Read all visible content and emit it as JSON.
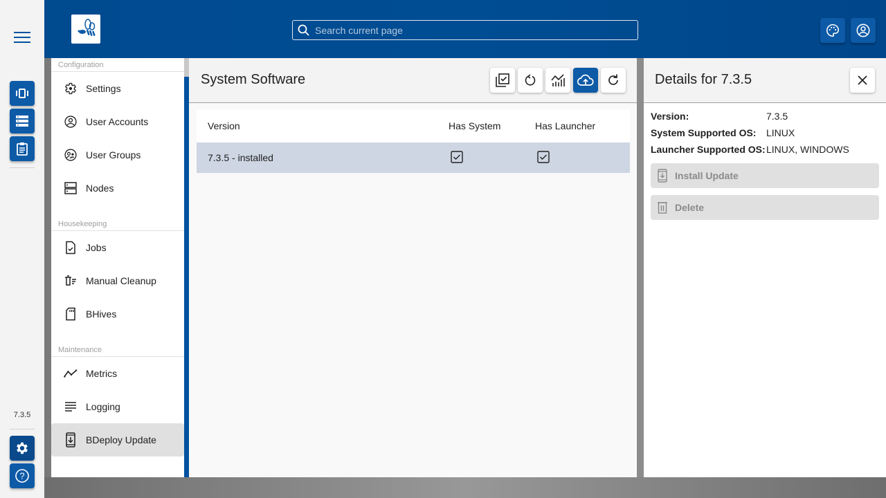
{
  "rail": {
    "version": "7.3.5",
    "buttons": [
      "instances-icon",
      "list-icon",
      "clipboard-icon"
    ],
    "bottom_buttons": [
      "settings-icon",
      "help-icon"
    ]
  },
  "header": {
    "search": {
      "placeholder": "Search current page",
      "value": ""
    },
    "buttons": [
      "palette-icon",
      "account-icon"
    ]
  },
  "nav": {
    "groups": [
      {
        "label": "Configuration",
        "items": [
          {
            "label": "Settings",
            "icon": "gear-icon"
          },
          {
            "label": "User Accounts",
            "icon": "account-circle-icon"
          },
          {
            "label": "User Groups",
            "icon": "group-icon"
          },
          {
            "label": "Nodes",
            "icon": "nodes-icon"
          }
        ]
      },
      {
        "label": "Housekeeping",
        "items": [
          {
            "label": "Jobs",
            "icon": "task-icon"
          },
          {
            "label": "Manual Cleanup",
            "icon": "cleanup-icon"
          },
          {
            "label": "BHives",
            "icon": "sd-card-icon"
          }
        ]
      },
      {
        "label": "Maintenance",
        "items": [
          {
            "label": "Metrics",
            "icon": "metrics-icon"
          },
          {
            "label": "Logging",
            "icon": "logging-icon"
          },
          {
            "label": "BDeploy Update",
            "icon": "system-update-icon",
            "active": true
          }
        ]
      }
    ]
  },
  "main": {
    "title": "System Software",
    "toolbar": [
      "select-multiple-icon",
      "restart-icon",
      "metrics-icon",
      "upload-cloud-icon",
      "refresh-icon"
    ],
    "table": {
      "columns": [
        "Version",
        "Has System",
        "Has Launcher"
      ],
      "rows": [
        {
          "version": "7.3.5 - installed",
          "has_system": true,
          "has_launcher": true,
          "selected": true
        }
      ]
    }
  },
  "details": {
    "title": "Details for 7.3.5",
    "fields": [
      {
        "label": "Version:",
        "value": "7.3.5"
      },
      {
        "label": "System Supported OS:",
        "value": "LINUX"
      },
      {
        "label": "Launcher Supported OS:",
        "value": "LINUX, WINDOWS"
      }
    ],
    "install_label": "Install Update",
    "delete_label": "Delete"
  },
  "colors": {
    "brand": "#004a90",
    "button": "#0d5aa7",
    "selected_row": "#ced6e3"
  }
}
